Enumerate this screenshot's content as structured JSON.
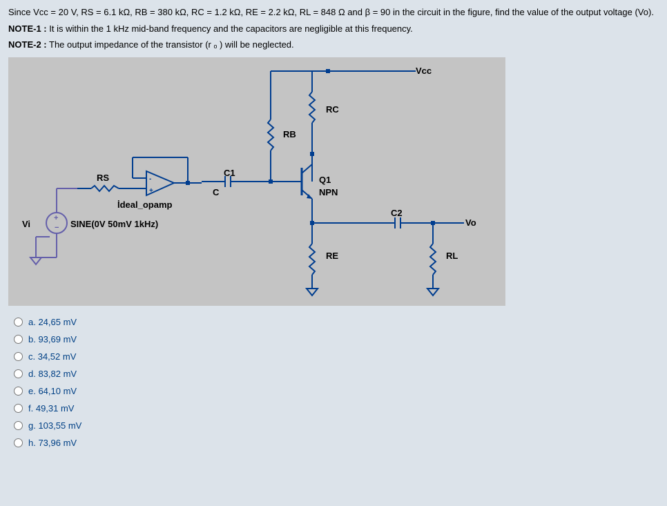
{
  "chart_data": {
    "type": "circuit",
    "components": {
      "Vcc": "20 V",
      "RS": "6.1 kΩ",
      "RB": "380 kΩ",
      "RC": "1.2 kΩ",
      "RE": "2.2 kΩ",
      "RL": "848 Ω",
      "beta": 90,
      "Vi_source": "SINE(0V 50mV 1kHz)",
      "opamp": "ideal_opamp",
      "transistor": "Q1 NPN",
      "capacitors": [
        "C1",
        "C2"
      ]
    }
  },
  "question": {
    "line1": "Since Vcc = 20 V, RS = 6.1 kΩ, RB = 380 kΩ, RC = 1.2 kΩ, RE = 2.2 kΩ, RL = 848 Ω and β = 90 in the circuit in the figure, find the value of the output voltage (Vo).",
    "note1_label": "NOTE-1 :",
    "note1_text": " It is within the 1 kHz mid-band frequency and the capacitors are negligible at this frequency.",
    "note2_label": "NOTE-2 :",
    "note2_text": " The output impedance of the transistor (r ₒ ) will be neglected."
  },
  "circuit_labels": {
    "Vcc": "Vcc",
    "RC": "RC",
    "RB": "RB",
    "C1": "C1",
    "C": "C",
    "RS": "RS",
    "ideal_opamp": "İdeal_opamp",
    "Vi": "Vi",
    "SINE": "SINE(0V 50mV 1kHz)",
    "Q1": "Q1",
    "NPN": "NPN",
    "C2": "C2",
    "Vo": "Vo",
    "RE": "RE",
    "RL": "RL"
  },
  "options": {
    "a": "a. 24,65 mV",
    "b": "b. 93,69 mV",
    "c": "c. 34,52 mV",
    "d": "d. 83,82 mV",
    "e": "e. 64,10 mV",
    "f": "f. 49,31 mV",
    "g": "g. 103,55 mV",
    "h": "h. 73,96 mV"
  }
}
